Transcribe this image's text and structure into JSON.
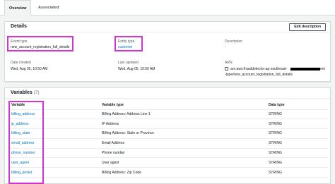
{
  "tabs": [
    {
      "label": "Overview",
      "active": true
    },
    {
      "label": "Associated resources",
      "active": false
    }
  ],
  "details": {
    "title": "Details",
    "edit_button": "Edit description",
    "event_type": {
      "label": "Event type",
      "value": "new_account_registration_full_details"
    },
    "entity_type": {
      "label": "Entity type",
      "value": "customer"
    },
    "description": {
      "label": "Description",
      "value": "-"
    },
    "date_created": {
      "label": "Date created",
      "value": "Wed, Aug 05, 10:50 AM"
    },
    "last_updated": {
      "label": "Last updated",
      "value": "Wed, Aug 05, 10:50 AM"
    },
    "arn": {
      "label": "ARN",
      "value_line1_start": "arn:aws:frauddetector:ap-southeast-",
      "value_line1_end": "ent",
      "value_line2": "-type/new_account_registration_full_details"
    }
  },
  "variables": {
    "title": "Variables",
    "count": "(7)",
    "columns": [
      "Variable",
      "Variable type",
      "Data type"
    ],
    "rows": [
      {
        "variable": "billing_address",
        "type": "Billing Address: Address Line 1",
        "data_type": "STRING"
      },
      {
        "variable": "ip_address",
        "type": "IP Address",
        "data_type": "STRING"
      },
      {
        "variable": "billing_state",
        "type": "Billing Address: State or Province",
        "data_type": "STRING"
      },
      {
        "variable": "email_address",
        "type": "Email Address",
        "data_type": "STRING"
      },
      {
        "variable": "phone_number",
        "type": "Phone number",
        "data_type": "STRING"
      },
      {
        "variable": "user_agent",
        "type": "User agent",
        "data_type": "STRING"
      },
      {
        "variable": "billing_postal",
        "type": "Billing Address: Zip Code",
        "data_type": "STRING"
      }
    ]
  },
  "colors": {
    "link": "#0073bb",
    "highlight": "#d633d6",
    "background": "#f2f3f3"
  }
}
